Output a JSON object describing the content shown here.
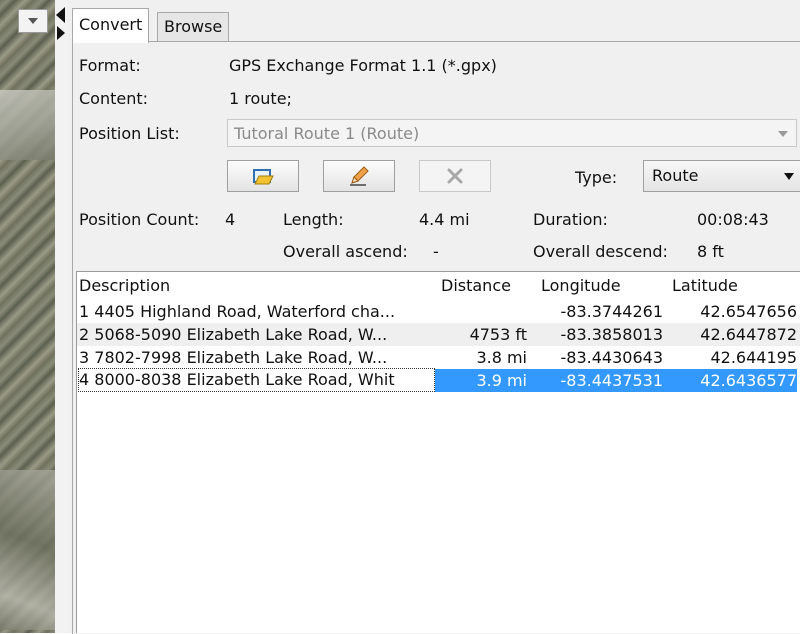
{
  "tabs": [
    {
      "label": "Convert",
      "active": true
    },
    {
      "label": "Browse",
      "active": false
    }
  ],
  "info": {
    "format_label": "Format:",
    "format_value": "GPS Exchange Format 1.1 (*.gpx)",
    "content_label": "Content:",
    "content_value": "1 route;",
    "position_list_label": "Position List:",
    "position_list_value": "Tutoral Route 1 (Route)"
  },
  "toolbar": {
    "type_label": "Type:",
    "type_value": "Route",
    "buttons": [
      {
        "icon": "folder-open-icon",
        "enabled": true
      },
      {
        "icon": "pencil-icon",
        "enabled": true
      },
      {
        "icon": "delete-x-icon",
        "enabled": false
      }
    ]
  },
  "stats": {
    "position_count_label": "Position Count:",
    "position_count_value": "4",
    "length_label": "Length:",
    "length_value": "4.4 mi",
    "duration_label": "Duration:",
    "duration_value": "00:08:43",
    "ascend_label": "Overall ascend:",
    "ascend_value": "-",
    "descend_label": "Overall descend:",
    "descend_value": "8 ft"
  },
  "table": {
    "columns": [
      "Description",
      "Distance",
      "Longitude",
      "Latitude"
    ],
    "rows": [
      {
        "description": "1 4405 Highland Road, Waterford cha...",
        "distance": "",
        "longitude": "-83.3744261",
        "latitude": "42.6547656"
      },
      {
        "description": "2 5068-5090 Elizabeth Lake Road, W...",
        "distance": "4753 ft",
        "longitude": "-83.3858013",
        "latitude": "42.6447872"
      },
      {
        "description": "3 7802-7998 Elizabeth Lake Road, W...",
        "distance": "3.8 mi",
        "longitude": "-83.4430643",
        "latitude": "42.644195"
      },
      {
        "description": "4 8000-8038 Elizabeth Lake Road, Whit",
        "distance": "3.9 mi",
        "longitude": "-83.4437531",
        "latitude": "42.6436577"
      }
    ],
    "selected_row": 3
  },
  "colors": {
    "selection": "#3399ff",
    "panel_bg": "#f0f0f0"
  }
}
